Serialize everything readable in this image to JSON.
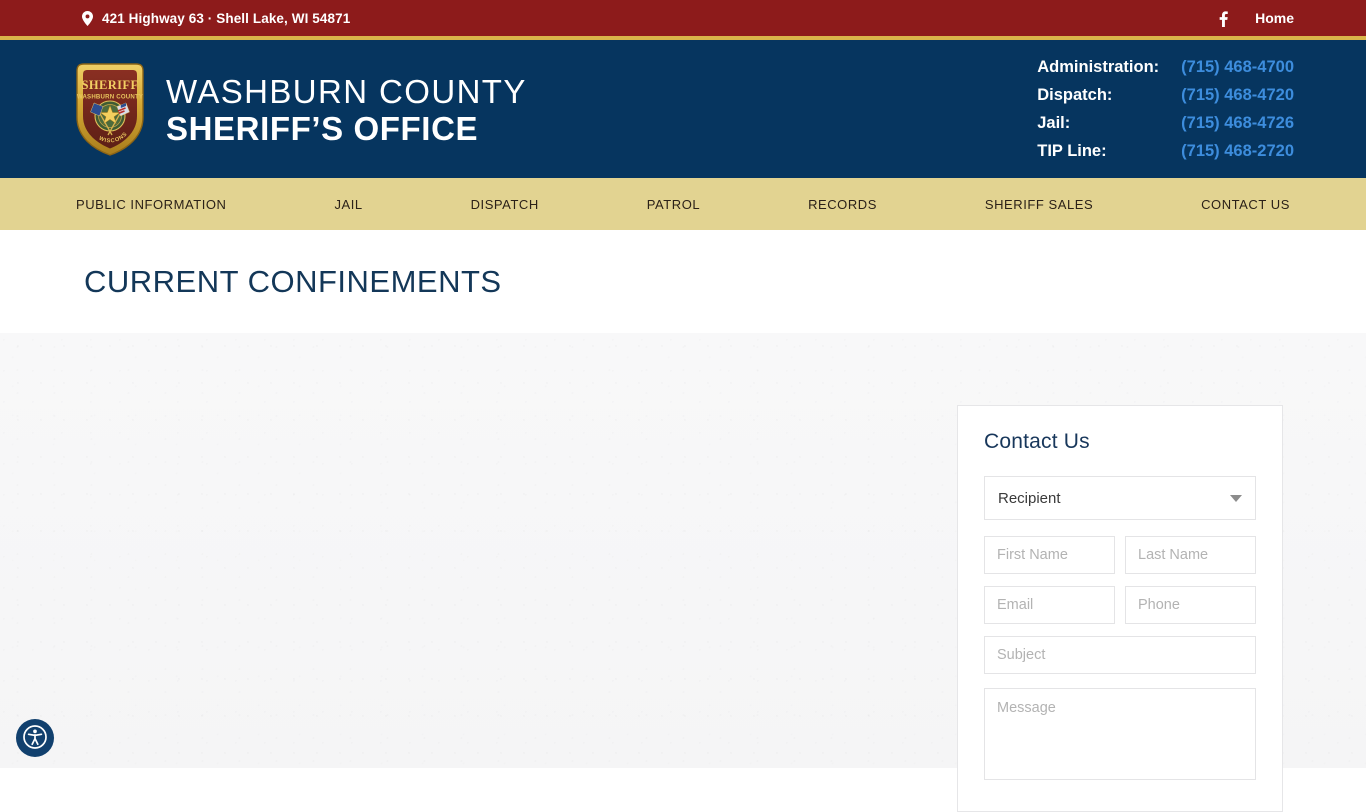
{
  "topbar": {
    "address": "421 Highway 63 · Shell Lake, WI 54871",
    "facebook_label": "f",
    "home_label": "Home",
    "bg_color": "#8d1b1b",
    "rule_color": "#d9b44a"
  },
  "header": {
    "brand_line1": "WASHBURN COUNTY",
    "brand_line2": "SHERIFF’S OFFICE",
    "bg_color": "#06355f",
    "badge": {
      "top_text": "SHERIFF",
      "county_text": "WASHBURN COUNTY",
      "bottom_text": "WISCONSIN"
    },
    "phones": [
      {
        "label": "Administration:",
        "number": "(715) 468-4700"
      },
      {
        "label": "Dispatch:",
        "number": "(715) 468-4720"
      },
      {
        "label": "Jail:",
        "number": "(715) 468-4726"
      },
      {
        "label": "TIP Line:",
        "number": "(715) 468-2720"
      }
    ],
    "phone_link_color": "#3d8ddd"
  },
  "nav": {
    "bg_color": "#e2d391",
    "items": [
      {
        "label": "PUBLIC INFORMATION"
      },
      {
        "label": "JAIL"
      },
      {
        "label": "DISPATCH"
      },
      {
        "label": "PATROL"
      },
      {
        "label": "RECORDS"
      },
      {
        "label": "SHERIFF SALES"
      },
      {
        "label": "CONTACT US"
      }
    ]
  },
  "page": {
    "title": "CURRENT CONFINEMENTS",
    "title_color": "#133758"
  },
  "contact_form": {
    "title": "Contact Us",
    "recipient_value": "Recipient",
    "recipient_options": [
      "Recipient"
    ],
    "first_name_placeholder": "First Name",
    "first_name_value": "",
    "last_name_placeholder": "Last Name",
    "last_name_value": "",
    "email_placeholder": "Email",
    "email_value": "",
    "phone_placeholder": "Phone",
    "phone_value": "",
    "subject_placeholder": "Subject",
    "subject_value": "",
    "message_placeholder": "Message",
    "message_value": ""
  },
  "accessibility": {
    "label": "Accessibility options",
    "bg_color": "#11406e"
  }
}
